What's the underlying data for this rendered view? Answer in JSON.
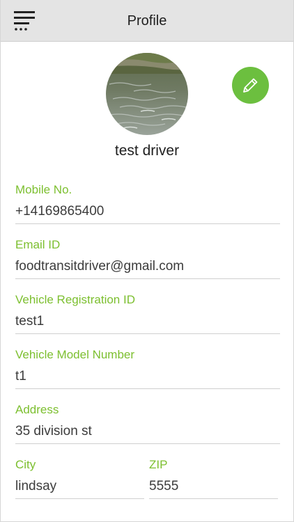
{
  "header": {
    "title": "Profile",
    "menu_icon": "hamburger-menu-icon"
  },
  "profile": {
    "name": "test driver",
    "avatar_icon": "profile-photo",
    "edit_icon": "pencil-icon"
  },
  "fields": {
    "mobile": {
      "label": "Mobile No.",
      "value": "+14169865400"
    },
    "email": {
      "label": "Email ID",
      "value": "foodtransitdriver@gmail.com"
    },
    "vehicle_registration": {
      "label": "Vehicle Registration ID",
      "value": "test1"
    },
    "vehicle_model": {
      "label": "Vehicle Model Number",
      "value": "t1"
    },
    "address": {
      "label": "Address",
      "value": "35 division st"
    },
    "city": {
      "label": "City",
      "value": "lindsay"
    },
    "zip": {
      "label": "ZIP",
      "value": "5555"
    }
  },
  "colors": {
    "accent": "#7cbf2f",
    "edit_button": "#6cbf3f",
    "nav_background": "#e4e4e4"
  }
}
